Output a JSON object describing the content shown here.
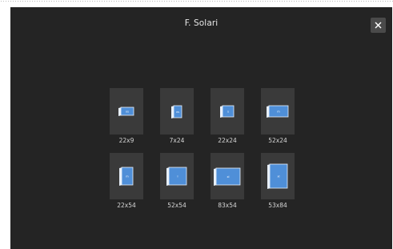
{
  "dialog": {
    "title": "F. Solari",
    "close_label": "×"
  },
  "formats": [
    {
      "label": "22x9",
      "code": "xs",
      "shape": "wide-small"
    },
    {
      "label": "7x24",
      "code": "xs",
      "shape": "tall-small"
    },
    {
      "label": "22x24",
      "code": "s",
      "shape": "square-small"
    },
    {
      "label": "52x24",
      "code": "m",
      "shape": "wide-medium"
    },
    {
      "label": "22x54",
      "code": "m",
      "shape": "tall-medium"
    },
    {
      "label": "52x54",
      "code": "l",
      "shape": "square-large"
    },
    {
      "label": "83x54",
      "code": "xl",
      "shape": "wide-large"
    },
    {
      "label": "53x84",
      "code": "xl",
      "shape": "tall-large"
    }
  ],
  "colors": {
    "page_dark": "#242424",
    "tile": "#3a3a3a",
    "book_blue": "#4f8fd8",
    "book_edge": "#e8f0fb",
    "text": "#d6d6d6"
  }
}
